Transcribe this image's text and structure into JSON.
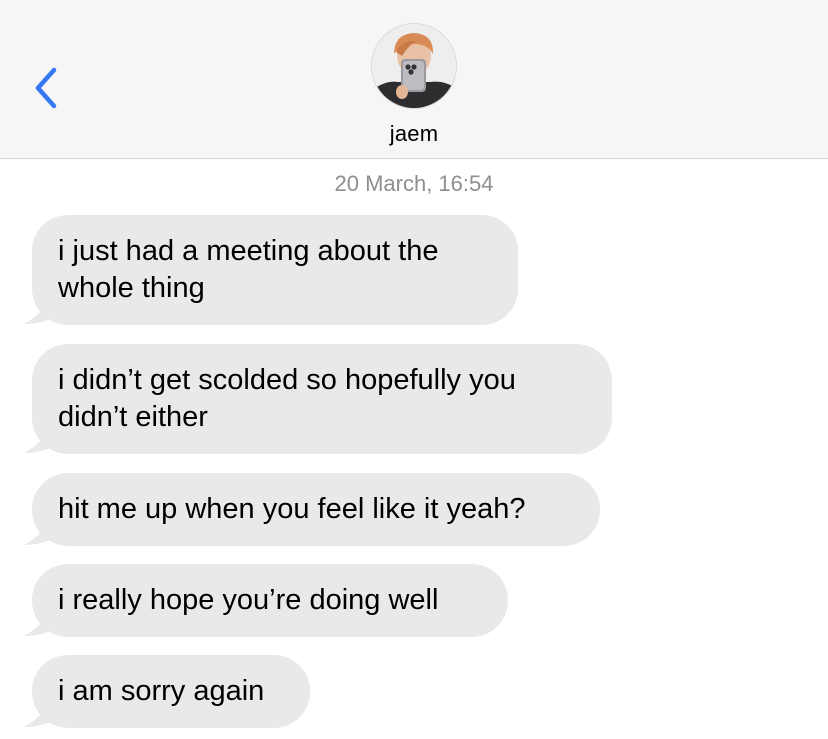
{
  "header": {
    "back_icon": "chevron-left-icon",
    "contact_name": "jaem",
    "accent_color": "#3478f6"
  },
  "thread": {
    "timestamp": "20 March, 16:54",
    "bubble_color": "#e9e9eb",
    "messages": [
      {
        "text": "i just had a meeting about the\nwhole thing",
        "direction": "incoming"
      },
      {
        "text": "i didn’t get scolded so hopefully you\ndidn’t either",
        "direction": "incoming"
      },
      {
        "text": "hit me up when you feel like it yeah?",
        "direction": "incoming"
      },
      {
        "text": "i really hope you’re doing well",
        "direction": "incoming"
      },
      {
        "text": "i am sorry again",
        "direction": "incoming"
      }
    ]
  }
}
